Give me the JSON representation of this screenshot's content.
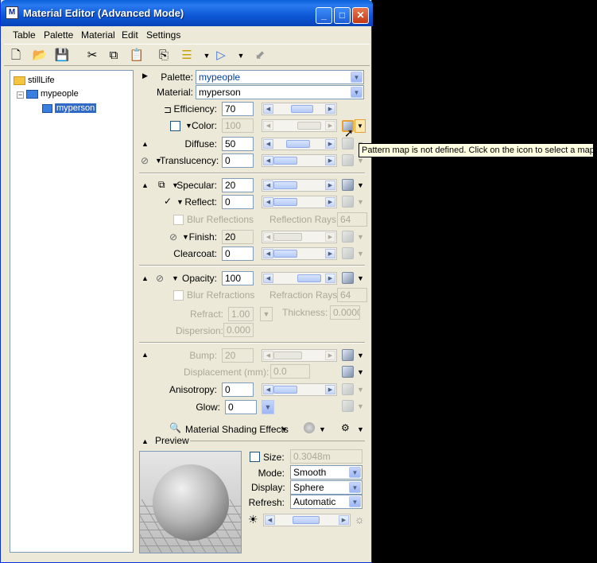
{
  "window": {
    "title": "Material Editor (Advanced Mode)",
    "icon_letter": "M"
  },
  "menu": [
    {
      "label": "Table"
    },
    {
      "label": "Palette"
    },
    {
      "label": "Material"
    },
    {
      "label": "Edit"
    },
    {
      "label": "Settings"
    }
  ],
  "tree": {
    "root": "stillLife",
    "palette": "mypeople",
    "material": "myperson"
  },
  "selectors": {
    "palette_label": "Palette:",
    "palette_value": "mypeople",
    "material_label": "Material:",
    "material_value": "myperson"
  },
  "props": {
    "efficiency": {
      "label": "Efficiency:",
      "value": "70"
    },
    "color": {
      "label": "Color:",
      "value": "100"
    },
    "diffuse": {
      "label": "Diffuse:",
      "value": "50"
    },
    "translucency": {
      "label": "Translucency:",
      "value": "0"
    },
    "specular": {
      "label": "Specular:",
      "value": "20"
    },
    "reflect": {
      "label": "Reflect:",
      "value": "0"
    },
    "blur_reflections": {
      "label": "Blur Reflections"
    },
    "reflection_rays": {
      "label": "Reflection Rays:",
      "value": "64"
    },
    "finish": {
      "label": "Finish:",
      "value": "20"
    },
    "clearcoat": {
      "label": "Clearcoat:",
      "value": "0"
    },
    "opacity": {
      "label": "Opacity:",
      "value": "100"
    },
    "blur_refractions": {
      "label": "Blur Refractions"
    },
    "refraction_rays": {
      "label": "Refraction Rays:",
      "value": "64"
    },
    "refract": {
      "label": "Refract:",
      "value": "1.00"
    },
    "thickness": {
      "label": "Thickness:",
      "value": "0.0000"
    },
    "dispersion": {
      "label": "Dispersion:",
      "value": "0.000"
    },
    "bump": {
      "label": "Bump:",
      "value": "20"
    },
    "displacement": {
      "label": "Displacement (mm):",
      "value": "0.0"
    },
    "anisotropy": {
      "label": "Anisotropy:",
      "value": "0"
    },
    "glow": {
      "label": "Glow:",
      "value": "0"
    }
  },
  "shading": {
    "label": "Material Shading Effects"
  },
  "preview": {
    "header": "Preview",
    "size_label": "Size:",
    "size_value": "0.3048m",
    "mode_label": "Mode:",
    "mode_value": "Smooth",
    "display_label": "Display:",
    "display_value": "Sphere",
    "refresh_label": "Refresh:",
    "refresh_value": "Automatic"
  },
  "tooltip": "Pattern map is not defined. Click on the icon to select a map."
}
